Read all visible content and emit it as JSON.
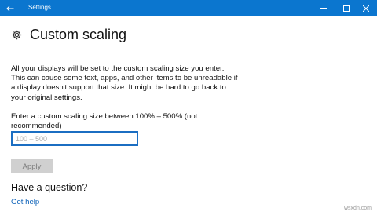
{
  "window": {
    "title": "Settings",
    "back_icon": "arrow-left-icon",
    "minimize_icon": "minimize-icon",
    "maximize_icon": "maximize-icon",
    "close_icon": "close-icon",
    "accent_color": "#0b76cf"
  },
  "page": {
    "icon": "gear-icon",
    "title": "Custom scaling",
    "description": "All your displays will be set to the custom scaling size you enter. This can cause some text, apps, and other items to be unreadable if a display doesn't support that size. It might be hard to go back to your original settings.",
    "prompt": "Enter a custom scaling size between 100% – 500% (not recommended)",
    "input": {
      "value": "",
      "placeholder": "100 – 500"
    },
    "apply_label": "Apply",
    "question": "Have a question?",
    "help_link": "Get help"
  },
  "watermark": "wsxdn.com"
}
